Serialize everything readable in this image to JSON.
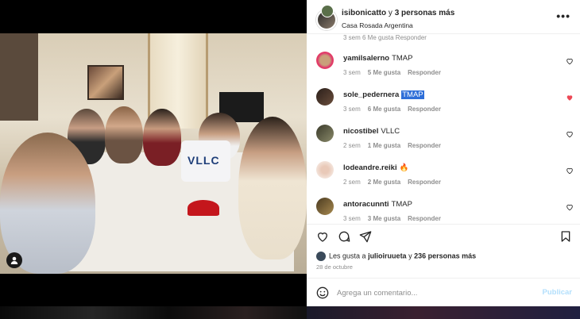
{
  "post": {
    "author": "isibonicatto",
    "connector": "y",
    "others": "3 personas más",
    "location": "Casa Rosada Argentina",
    "photo_text": "VLLC"
  },
  "partial_comment_meta": "3 sem   6 Me gusta   Responder",
  "comments": [
    {
      "user": "yamilsalerno",
      "text": "TMAP",
      "time": "3 sem",
      "likes": "5 Me gusta",
      "reply": "Responder",
      "liked": false
    },
    {
      "user": "sole_pedernera",
      "text": "TMAP",
      "time": "3 sem",
      "likes": "6 Me gusta",
      "reply": "Responder",
      "liked": true
    },
    {
      "user": "nicostibel",
      "text": "VLLC",
      "time": "2 sem",
      "likes": "1 Me gusta",
      "reply": "Responder",
      "liked": false
    },
    {
      "user": "lodeandre.reiki",
      "text": "🔥",
      "time": "2 sem",
      "likes": "2 Me gusta",
      "reply": "Responder",
      "liked": false
    },
    {
      "user": "antoracunnti",
      "text": "TMAP",
      "time": "3 sem",
      "likes": "3 Me gusta",
      "reply": "Responder",
      "liked": false
    }
  ],
  "likes": {
    "prefix": "Les gusta a",
    "user": "julioiruueta",
    "connector": "y",
    "others": "236 personas más"
  },
  "date": "28 de octubre",
  "add_comment": {
    "placeholder": "Agrega un comentario...",
    "publish": "Publicar"
  },
  "colors": {
    "heart_liked": "#ed4956",
    "highlight": "#2f6fd8",
    "publish_disabled": "#b2dffc"
  }
}
